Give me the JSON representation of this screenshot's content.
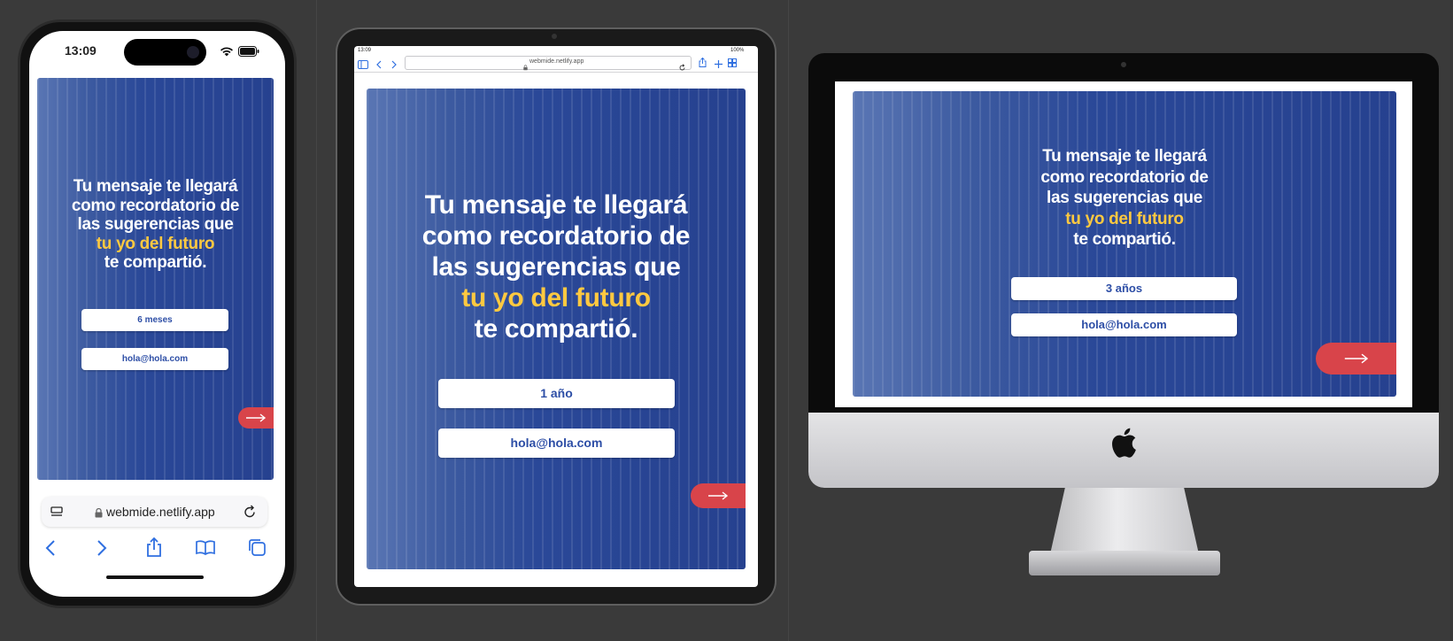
{
  "brand": {
    "blue": "#2a4898",
    "highlight": "#ffc940",
    "button_red": "#d8444a"
  },
  "headline": {
    "line1": "Tu mensaje te llegará",
    "line2": "como recordatorio de",
    "line3": "las sugerencias que",
    "highlight": "tu yo del futuro",
    "line5": "te compartió."
  },
  "email_value": "hola@hola.com",
  "phone": {
    "time": "13:09",
    "period_value": "6 meses",
    "url": "webmide.netlify.app"
  },
  "tablet": {
    "time": "13:09",
    "battery": "100%",
    "url": "webmide.netlify.app",
    "period_value": "1 año"
  },
  "imac": {
    "period_value": "3 años"
  },
  "icons": [
    "wifi-icon",
    "battery-icon",
    "lock-icon",
    "reload-icon",
    "back-icon",
    "forward-icon",
    "share-icon",
    "bookmarks-icon",
    "tabs-icon",
    "arrow-right-icon",
    "apple-logo-icon",
    "sidebar-icon",
    "new-tab-icon"
  ]
}
